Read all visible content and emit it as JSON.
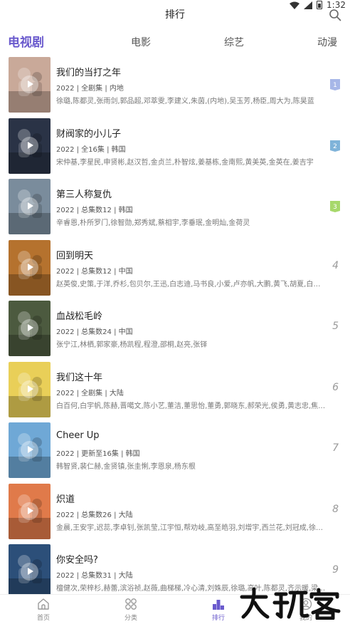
{
  "status": {
    "time": "1:32"
  },
  "header": {
    "title": "排行"
  },
  "tabs": [
    "电视剧",
    "电影",
    "综艺",
    "动漫"
  ],
  "items": [
    {
      "title": "我们的当打之年",
      "meta": "2022 | 全剧集 | 内地",
      "cast": "徐璐,陈都灵,张雨剑,郭品超,邓萃雯,李建义,朱茵,(内地),吴玉芳,杨臣,周大为,陈昊蓝",
      "rank": "1",
      "badge_color": "#a7b7e8",
      "poster_color": "#c9a999"
    },
    {
      "title": "财阀家的小儿子",
      "meta": "2022 | 全16集 | 韩国",
      "cast": "宋仲基,李星民,申贤彬,赵汉哲,金贞兰,朴智炫,姜基栋,金南熙,黄美英,金英在,姜吉宇",
      "rank": "2",
      "badge_color": "#7fb3d9",
      "poster_color": "#2a3346"
    },
    {
      "title": "第三人称复仇",
      "meta": "2022 | 总集数12 | 韩国",
      "cast": "辛睿恩,朴所罗门,徐智勋,郑秀斌,蔡相宇,李垂珉,金明灿,金荷灵",
      "rank": "3",
      "badge_color": "#a7d86b",
      "poster_color": "#7a8c9c"
    },
    {
      "title": "回到明天",
      "meta": "2022 | 总集数12 | 中国",
      "cast": "赵英俊,史策,于洋,乔杉,包贝尔,王迅,白志迪,马书良,小爱,卢亦帆,大鹏,黄飞,胡夏,白客,崔志",
      "rank": "4",
      "badge_color": "",
      "poster_color": "#b5722e"
    },
    {
      "title": "血战松毛岭",
      "meta": "2022 | 总集数24 | 中国",
      "cast": "张宁江,林栖,郭家豪,杨凯程,程澄,邵桐,赵亮,张铎",
      "rank": "5",
      "badge_color": "",
      "poster_color": "#4c5a3f"
    },
    {
      "title": "我们这十年",
      "meta": "2022 | 全剧集 | 大陆",
      "cast": "白百何,白宇帆,陈赫,晋噶文,陈小艺,董洁,董思怡,董勇,郭晓东,郝荣光,侯勇,黄志忠,焦俊艳,",
      "rank": "6",
      "badge_color": "",
      "poster_color": "#e9cf58"
    },
    {
      "title": "Cheer Up",
      "meta": "2022 | 更新至16集 | 韩国",
      "cast": "韩智贤,裴仁赫,金贤镇,张圭悧,李恩泉,杨东根",
      "rank": "7",
      "badge_color": "",
      "poster_color": "#6fa8d6"
    },
    {
      "title": "炽道",
      "meta": "2022 | 总集数26 | 大陆",
      "cast": "金晨,王安宇,迟蕊,李卓钊,张凯莹,江宇恒,帮劝岐,高至皓羽,刘增宇,西兰花,刘冠成,徐洁儿",
      "rank": "8",
      "badge_color": "",
      "poster_color": "#e07a4a"
    },
    {
      "title": "你安全吗?",
      "meta": "2022 | 总集数31 | 大陆",
      "cast": "檀健次,荣梓杉,赫蕾,滨浴祯,赵薇,曲梯梯,冷心清,刘姝辰,徐璐,高叶,陈都灵,齐示暖,梁大维",
      "rank": "9",
      "badge_color": "",
      "poster_color": "#2c4f79"
    }
  ],
  "bottom_nav": [
    {
      "label": "首页",
      "icon": "home-icon"
    },
    {
      "label": "分类",
      "icon": "grid-icon"
    },
    {
      "label": "排行",
      "icon": "rank-icon"
    },
    {
      "label": "我的",
      "icon": "user-icon"
    }
  ],
  "watermark": "大玩客",
  "colors": {
    "accent": "#6a5acd"
  }
}
